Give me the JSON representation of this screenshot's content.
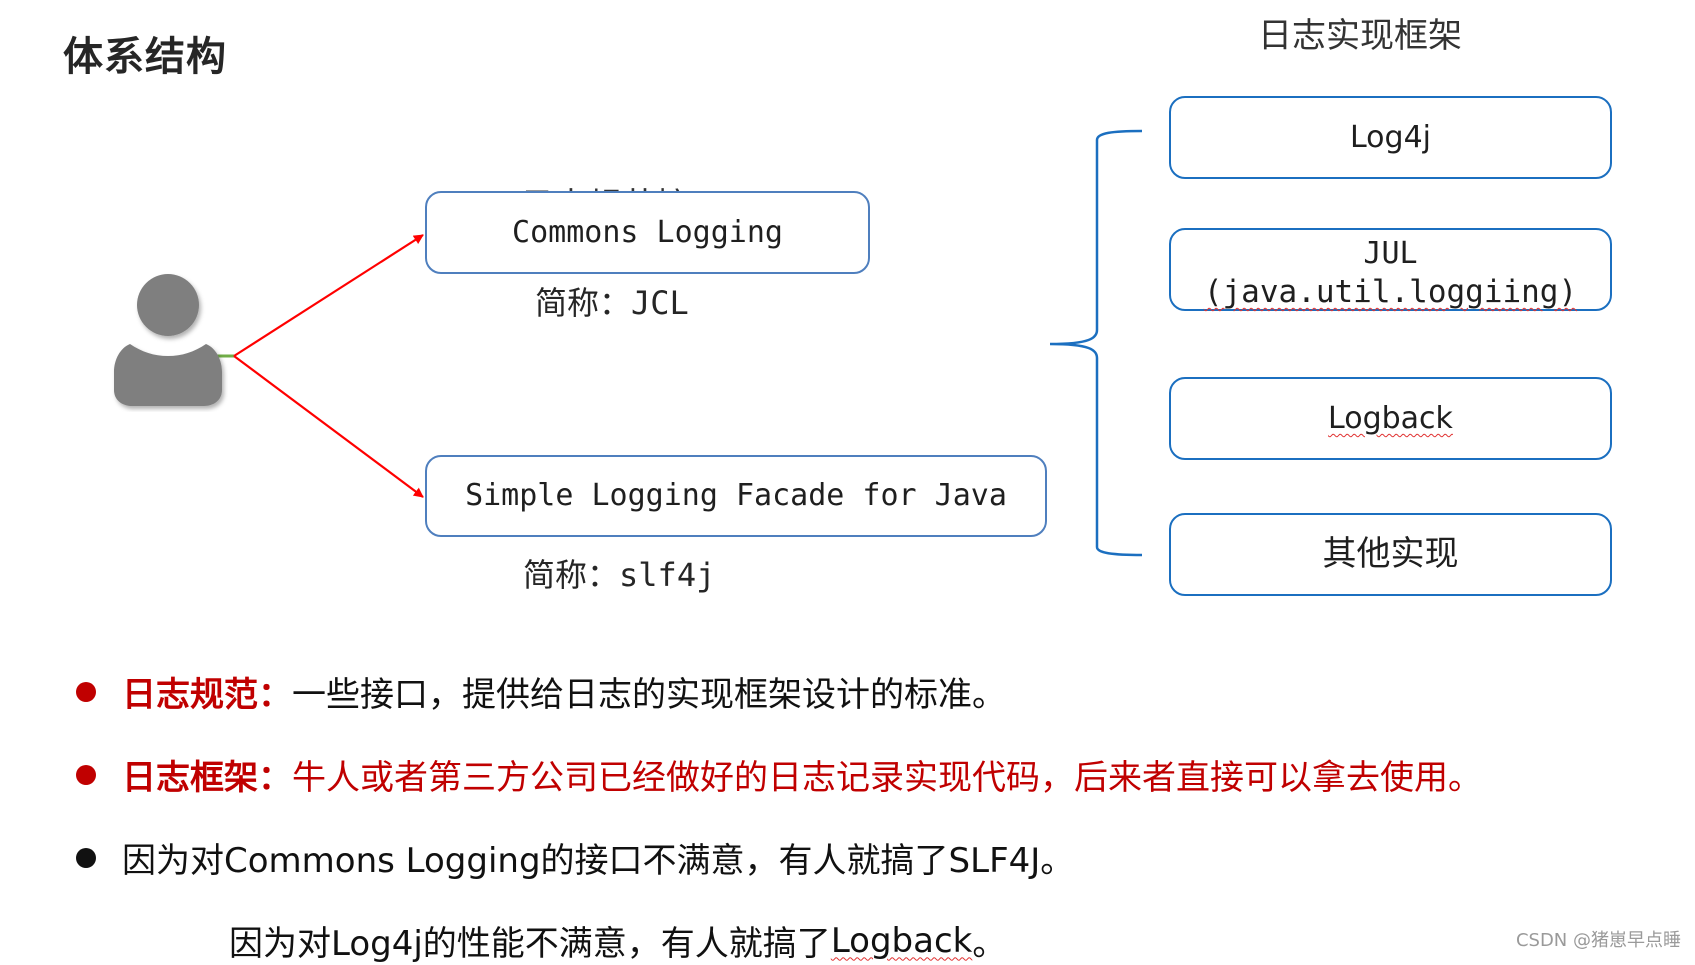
{
  "page_title": "体系结构",
  "interfaces": {
    "heading": "日志规范接口",
    "items": [
      {
        "name": "Commons Logging",
        "abbr_label": "简称：",
        "abbr": "JCL"
      },
      {
        "name": "Simple Logging Facade for Java",
        "abbr_label": "简称：",
        "abbr": "slf4j"
      }
    ]
  },
  "implementations": {
    "heading": "日志实现框架",
    "items": [
      {
        "line1": "Log4j",
        "line2": ""
      },
      {
        "line1": "JUL",
        "line2": "(java.util.loggiing)"
      },
      {
        "line1": "Logback",
        "line2": ""
      },
      {
        "line1": "其他实现",
        "line2": ""
      }
    ]
  },
  "user_icon": "user-icon",
  "colors": {
    "arrow": "#ff0000",
    "interface_border": "#4f7fbe",
    "impl_border": "#1b6fc0",
    "brace": "#1b6fc0",
    "emphasis": "#c00000"
  },
  "bullets": [
    {
      "key": "日志规范：",
      "text": "一些接口，提供给日志的实现框架设计的标准。",
      "style": "red-key"
    },
    {
      "key": "日志框架：",
      "text": "牛人或者第三方公司已经做好的日志记录实现代码，后来者直接可以拿去使用。",
      "style": "red-all"
    },
    {
      "key": "",
      "text": "因为对Commons Logging的接口不满意，有人就搞了SLF4J。",
      "style": "plain"
    }
  ],
  "continuation": {
    "before": "因为对Log4j的性能不满意，有人就搞了",
    "spell_word": "Logback",
    "after": "。"
  },
  "watermark": "CSDN @猪崽早点睡"
}
